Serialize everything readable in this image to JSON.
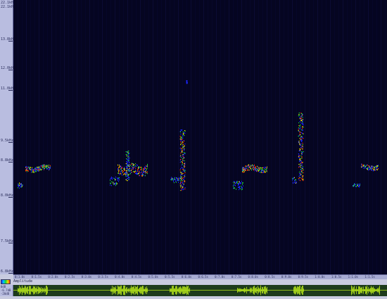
{
  "frequency_axis": {
    "top_labels": [
      "22.1kHz",
      "22.1kHz"
    ],
    "ticks": [
      {
        "label": "13.8kHz",
        "level": 0.893
      },
      {
        "label": "12.0kHz",
        "level": 0.781
      },
      {
        "label": "11.0kHz",
        "level": 0.702
      },
      {
        "label": "9.5kHz",
        "level": 0.502
      },
      {
        "label": "8.8kHz",
        "level": 0.427
      },
      {
        "label": "8.0kHz",
        "level": 0.293
      },
      {
        "label": "7.5kHz",
        "level": 0.115
      },
      {
        "label": "6.8kHz",
        "level": 0.0
      }
    ]
  },
  "time_axis": {
    "labels": [
      "0:1.0s",
      "0:1.5s",
      "0:2.0s",
      "0:2.5s",
      "0:3.0s",
      "0:3.5s",
      "0:4.0s",
      "0:4.5s",
      "0:5.0s",
      "0:5.5s",
      "0:6.0s",
      "0:6.5s",
      "0:7.0s",
      "0:7.5s",
      "0:8.0s",
      "0:8.5s",
      "0:9.0s",
      "0:9.5s",
      "1:0.0s",
      "1:0.5s",
      "1:1.0s",
      "1:1.5s"
    ]
  },
  "amplitude": {
    "label": "Amplitude",
    "scale_labels": [
      "0dB",
      "-6.7dB",
      "-20dB"
    ]
  },
  "colors": {
    "background": "#050521",
    "low": "#1c27ff",
    "mid": "#18d43a",
    "high": "#e8e000",
    "peak": "#ff2a00",
    "waveform": "#b8e81a"
  },
  "icons": {
    "palette": "color-palette-icon"
  }
}
